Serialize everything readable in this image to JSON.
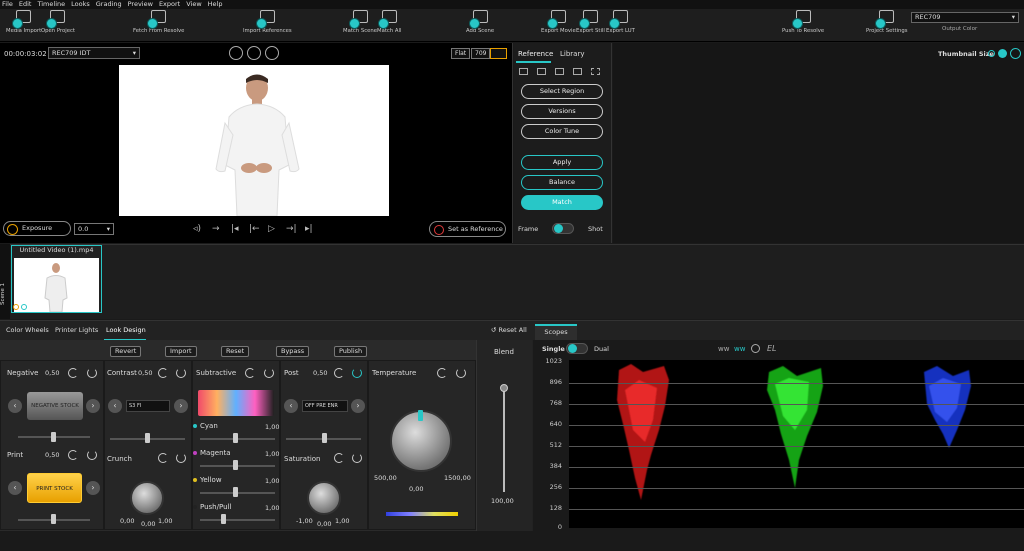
{
  "menu": [
    "File",
    "Edit",
    "Timeline",
    "Looks",
    "Grading",
    "Preview",
    "Export",
    "View",
    "Help"
  ],
  "toolbar": {
    "left": [
      "Media Import",
      "Open Project",
      "Fetch From Resolve",
      "Import References",
      "Match Scene",
      "Match All",
      "Add Scene",
      "Export Movie",
      "Export Still",
      "Export LUT",
      "Push To Resolve",
      "Project Settings"
    ],
    "output_color_value": "REC709",
    "output_color_label": "Output Color"
  },
  "viewer": {
    "timecode": "00:00:03:02",
    "idt": "REC709 IDT",
    "flat": "Flat",
    "rec": "709",
    "exposure_label": "Exposure",
    "exposure_value": "0.0",
    "set_reference": "Set as Reference"
  },
  "reference": {
    "tab_reference": "Reference",
    "tab_library": "Library",
    "select_region": "Select Region",
    "versions": "Versions",
    "color_tune": "Color Tune",
    "apply": "Apply",
    "balance": "Balance",
    "match": "Match",
    "frame": "Frame",
    "shot": "Shot",
    "thumbnail_size": "Thumbnail Size"
  },
  "timeline": {
    "scene_label": "Scene 1",
    "clip_name": "Untitled Video (1).mp4"
  },
  "tabs": {
    "color_wheels": "Color Wheels",
    "printer_lights": "Printer Lights",
    "look_design": "Look Design",
    "reset_all": "Reset All"
  },
  "look": {
    "buttons": [
      "Revert",
      "Import",
      "Reset",
      "Bypass",
      "Publish"
    ],
    "negative": "Negative",
    "negative_val": "0,50",
    "negative_stock": "NEGATIVE STOCK",
    "print": "Print",
    "print_val": "0,50",
    "print_stock": "PRINT STOCK",
    "contrast": "Contrast",
    "contrast_val": "0,50",
    "contrast_sel": "S3   FI",
    "crunch": "Crunch",
    "crunch_min": "0,00",
    "crunch_val": "0,00",
    "crunch_max": "1,00",
    "subtractive": "Subtractive",
    "cyan": "Cyan",
    "cyan_val": "1,00",
    "magenta": "Magenta",
    "magenta_val": "1,00",
    "yellow": "Yellow",
    "yellow_val": "1,00",
    "pushpull": "Push/Pull",
    "pushpull_val": "1,00",
    "post": "Post",
    "post_val": "0,50",
    "post_sel": "OFF   PRE   ENR",
    "saturation": "Saturation",
    "sat_min": "-1,00",
    "sat_val": "0,00",
    "sat_max": "1,00",
    "temperature": "Temperature",
    "temp_min": "500,00",
    "temp_val": "0,00",
    "temp_max": "1500,00",
    "blend": "Blend",
    "blend_val": "100,00"
  },
  "scopes": {
    "tab": "Scopes",
    "single": "Single",
    "dual": "Dual",
    "el": "EL",
    "y_ticks": [
      "1023",
      "896",
      "768",
      "640",
      "512",
      "384",
      "256",
      "128",
      "0"
    ]
  },
  "colors": {
    "accent": "#28c7c7",
    "print_stock": "#f5b800"
  }
}
